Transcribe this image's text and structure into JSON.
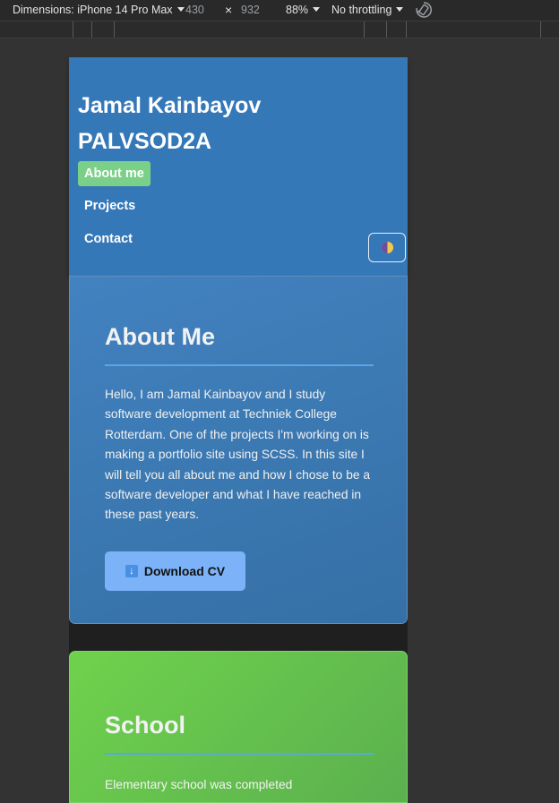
{
  "devtools": {
    "dimensions_label": "Dimensions: iPhone 14 Pro Max",
    "width": "430",
    "times": "×",
    "height": "932",
    "zoom": "88%",
    "throttling": "No throttling"
  },
  "header": {
    "title_line1": "Jamal Kainbayov",
    "title_line2": "PALVSOD2A",
    "nav": [
      {
        "label": "About me",
        "active": true
      },
      {
        "label": "Projects",
        "active": false
      },
      {
        "label": "Contact",
        "active": false
      }
    ],
    "theme_toggle_icon": "half-moon-icon"
  },
  "about": {
    "title": "About Me",
    "text": "Hello, I am Jamal Kainbayov and I study software development at Techniek College Rotterdam. One of the projects I'm working on is making a portfolio site using SCSS. In this site I will tell you all about me and how I chose to be a software developer and what I have reached in these past years.",
    "cv_icon": "↓",
    "cv_label": "Download CV"
  },
  "school": {
    "title": "School",
    "text": "Elementary school was completed"
  },
  "colors": {
    "header_bg": "#3578b8",
    "nav_active_bg": "#7bd089",
    "cv_button_bg": "#7cb2f7",
    "school_bg": "#6fd24c",
    "rule": "#58a7e6"
  }
}
